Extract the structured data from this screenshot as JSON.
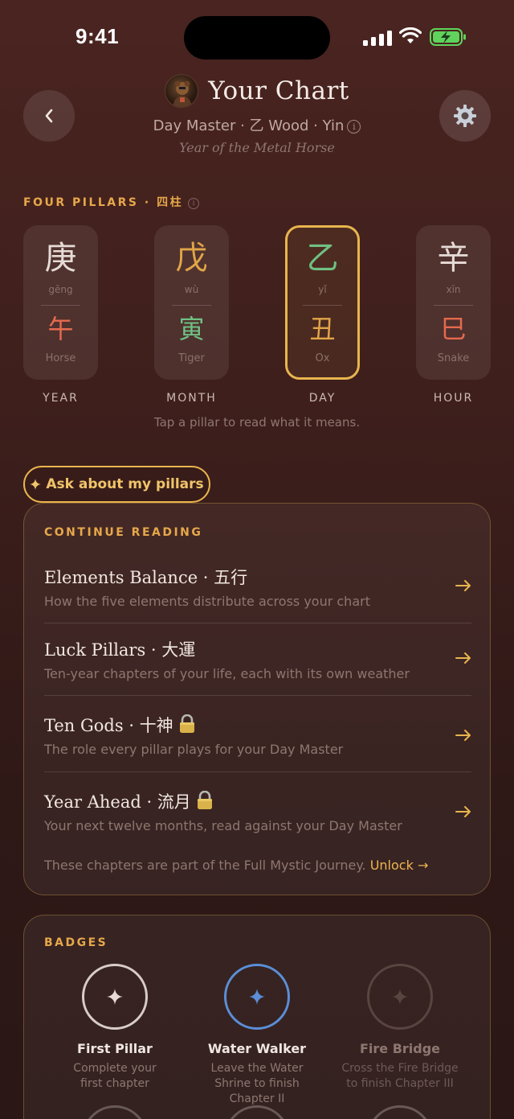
{
  "status_bar": {
    "time": "9:41"
  },
  "header": {
    "title": "Your Chart",
    "subtitle": "Day Master · 乙 Wood · Yin",
    "info_glyph": "i",
    "tagline": "Year of the Metal Horse",
    "back_icon": "chevron-left-icon",
    "settings_icon": "gear-icon"
  },
  "four_pillars": {
    "label": "FOUR PILLARS · 四柱",
    "info_glyph": "i",
    "hint": "Tap a pillar to read what it means.",
    "pillars": [
      {
        "stem": "庚",
        "stem_pinyin": "gēng",
        "stem_color": "#e6dbd6",
        "branch": "午",
        "branch_animal": "Horse",
        "branch_color": "#e56a4e",
        "label": "YEAR",
        "active": false
      },
      {
        "stem": "戊",
        "stem_pinyin": "wù",
        "stem_color": "#e0a548",
        "branch": "寅",
        "branch_animal": "Tiger",
        "branch_color": "#6fc083",
        "label": "MONTH",
        "active": false
      },
      {
        "stem": "乙",
        "stem_pinyin": "yǐ",
        "stem_color": "#6fc083",
        "branch": "丑",
        "branch_animal": "Ox",
        "branch_color": "#e0a548",
        "label": "DAY",
        "active": true
      },
      {
        "stem": "辛",
        "stem_pinyin": "xīn",
        "stem_color": "#e6dbd6",
        "branch": "巳",
        "branch_animal": "Snake",
        "branch_color": "#e56a4e",
        "label": "HOUR",
        "active": false
      }
    ]
  },
  "ask_button": {
    "label": "Ask about my pillars",
    "icon": "sparkle-icon"
  },
  "continue_reading": {
    "label": "CONTINUE READING",
    "items": [
      {
        "title": "Elements Balance · 五行",
        "description": "How the five elements distribute across your chart",
        "locked": false
      },
      {
        "title": "Luck Pillars · 大運",
        "description": "Ten-year chapters of your life, each with its own weather",
        "locked": false
      },
      {
        "title": "Ten Gods · 十神",
        "description": "The role every pillar plays for your Day Master",
        "locked": true
      },
      {
        "title": "Year Ahead · 流月",
        "description": "Your next twelve months, read against your Day Master",
        "locked": true
      }
    ],
    "note": "These chapters are part of the Full Mystic Journey.",
    "unlock_label": "Unlock →"
  },
  "badges": {
    "label": "BADGES",
    "items": [
      {
        "name": "First Pillar",
        "description": "Complete your first chapter",
        "state": "earned",
        "ring_color": "#d8ccc8"
      },
      {
        "name": "Water Walker",
        "description": "Leave the Water Shrine to finish Chapter II",
        "state": "earned",
        "ring_color": "#5b8ed6"
      },
      {
        "name": "Fire Bridge",
        "description": "Cross the Fire Bridge to finish Chapter III",
        "state": "locked",
        "ring_color": "#5a4440"
      }
    ]
  },
  "colors": {
    "accent": "#e8b54e",
    "background": "#3e1f1c"
  }
}
